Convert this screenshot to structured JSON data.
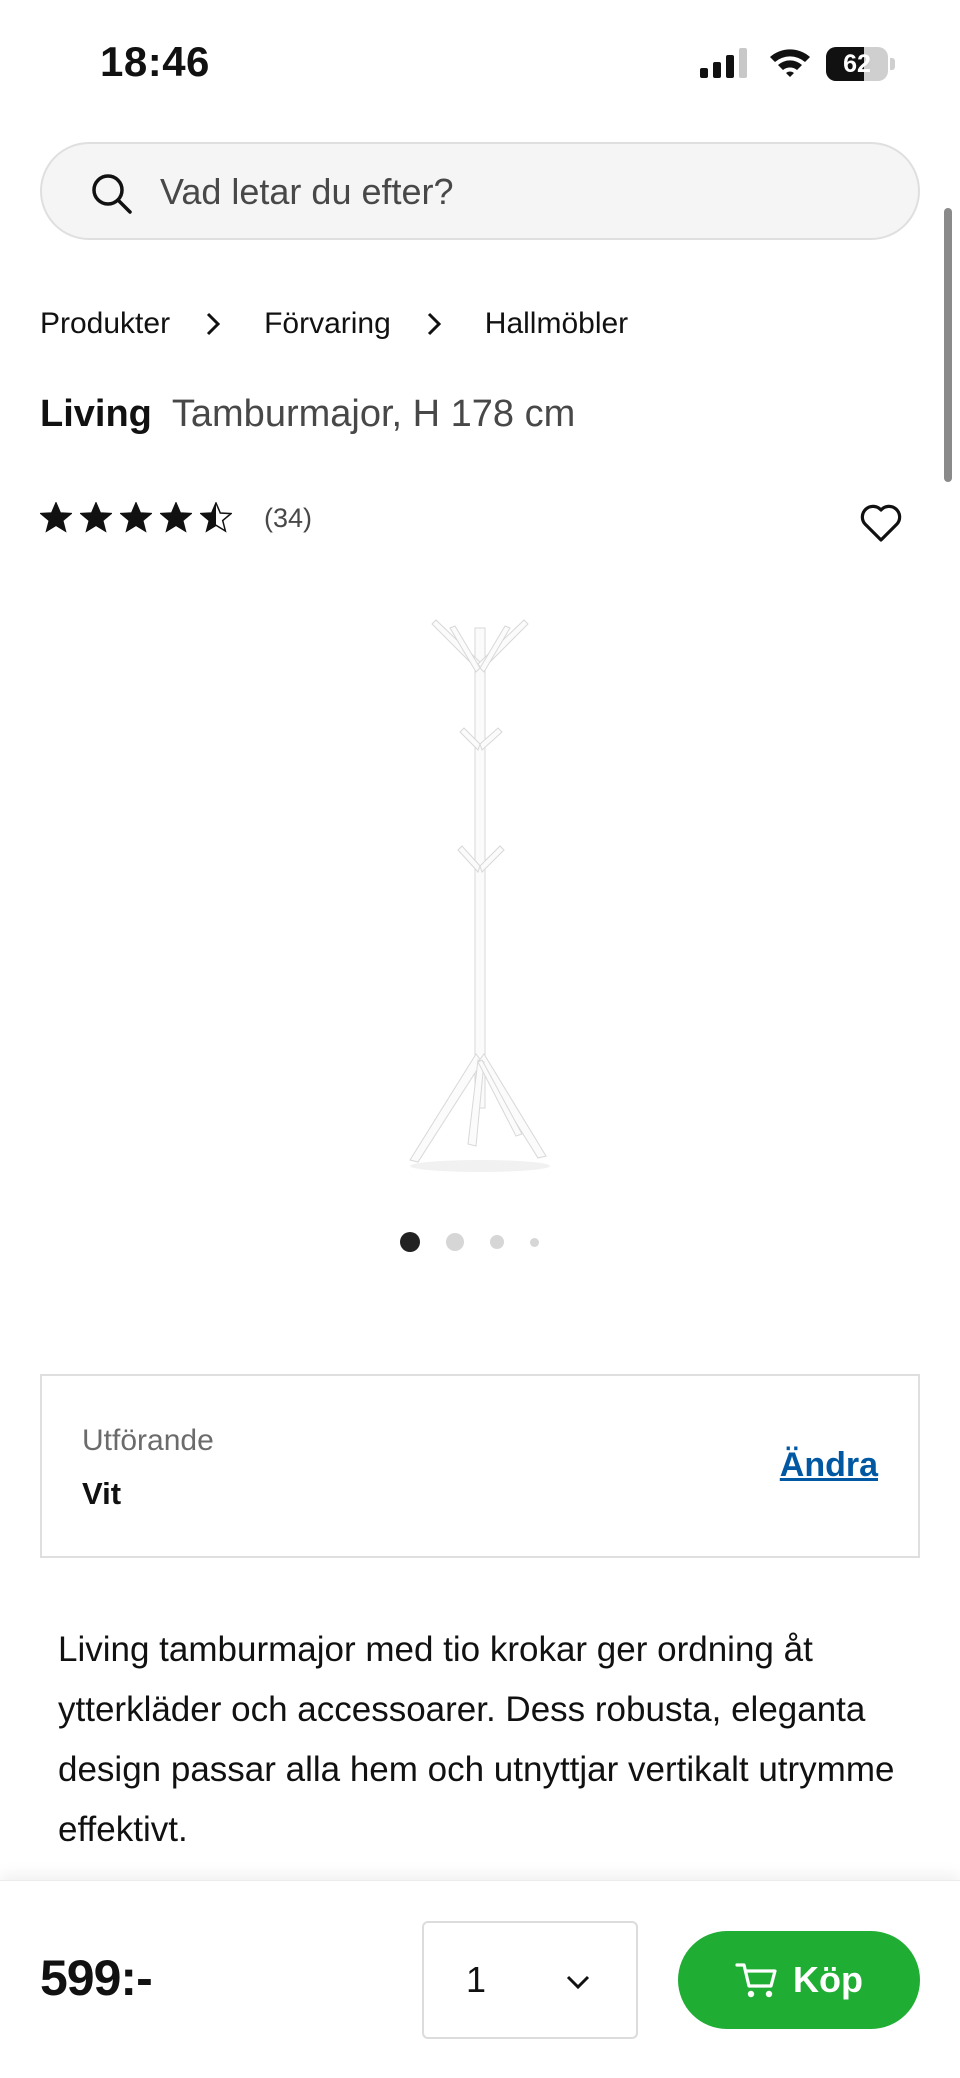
{
  "status_bar": {
    "time": "18:46",
    "signal_bars_active": 3,
    "signal_bars_total": 4,
    "battery_percent": 62,
    "battery_text": "62"
  },
  "search": {
    "placeholder": "Vad letar du efter?",
    "icon": "search-icon"
  },
  "breadcrumb": [
    "Produkter",
    "Förvaring",
    "Hallmöbler"
  ],
  "product": {
    "brand": "Living",
    "description": "Tamburmajor, H 178 cm",
    "rating": 4.5,
    "rating_max": 5,
    "review_count": "(34)",
    "image_alt_icon": "coat-stand-image"
  },
  "carousel": {
    "count": 4,
    "active_index": 0
  },
  "variant": {
    "label": "Utförande",
    "value": "Vit",
    "change_label": "Ändra"
  },
  "body_text": "Living tamburmajor med tio krokar ger ordning åt ytterkläder och accessoarer. Dess robusta, eleganta design passar alla hem och utnyttjar vertikalt utrymme effektivt.",
  "purchase": {
    "price": "599:-",
    "quantity": "1",
    "buy_label": "Köp"
  },
  "colors": {
    "buy_button": "#1fad34",
    "link": "#0058a3",
    "text": "#111111",
    "muted": "#484848"
  }
}
